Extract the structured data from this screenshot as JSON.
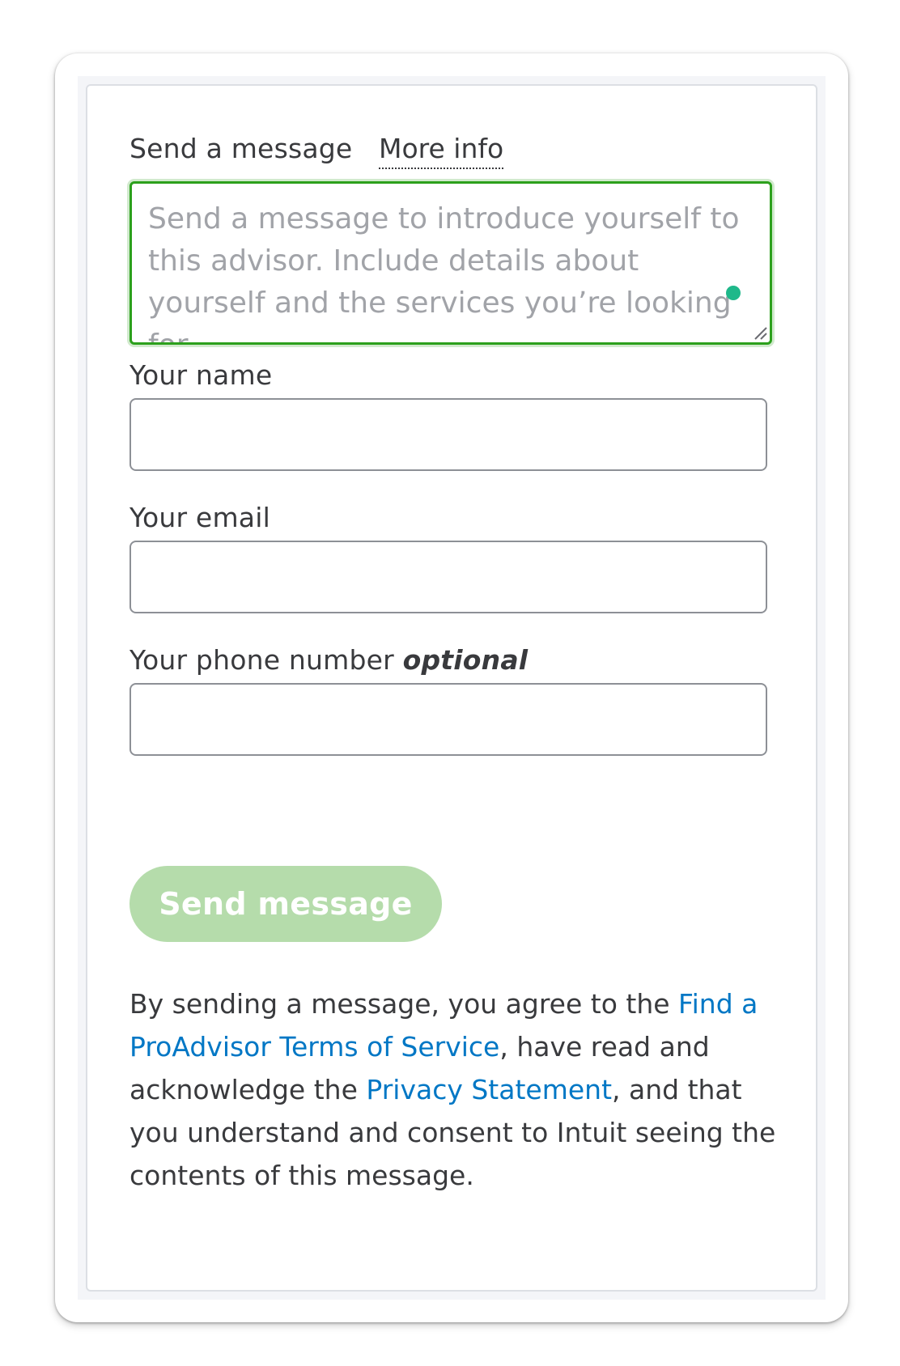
{
  "form": {
    "message_label": "Send a message",
    "more_info_link": "More info",
    "message_placeholder": "Send a message to introduce yourself to this advisor. Include details about yourself and the services you’re looking for.",
    "message_value": "",
    "name_label": "Your name",
    "name_value": "",
    "email_label": "Your email",
    "email_value": "",
    "phone_label": "Your phone number",
    "phone_optional": "optional",
    "phone_value": "",
    "send_button": "Send message"
  },
  "legal": {
    "text_1": "By sending a message, you agree to the ",
    "terms_link": "Find a ProAdvisor Terms of Service",
    "text_2": ", have read and acknowledge the ",
    "privacy_link": "Privacy Statement",
    "text_3": ", and that you understand and consent to Intuit seeing the contents of this message."
  },
  "colors": {
    "focus_border": "#2ca01c",
    "button_disabled": "#b5dcab",
    "link": "#0077c5",
    "text": "#393a3d",
    "status_dot": "#1fb88a"
  },
  "icons": {
    "status_dot": "green-dot-icon",
    "resize": "resize-handle-icon"
  }
}
